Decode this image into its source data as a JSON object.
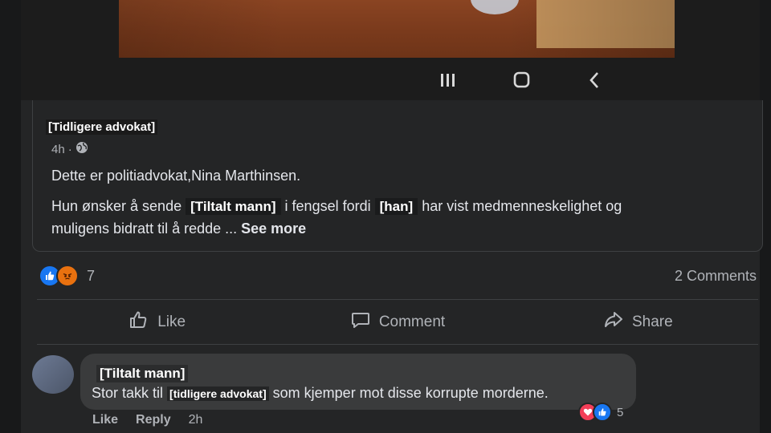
{
  "post": {
    "author": "[Tidligere advokat]",
    "time": "4h",
    "line1": "Dette er politiadvokat,Nina Marthinsen.",
    "line2_a": "Hun ønsker å sende",
    "line2_tag1": "[Tiltalt mann]",
    "line2_b": "i fengsel fordi",
    "line2_tag2": "[han]",
    "line2_c": "har  vist medmenneskelighet og",
    "line3_a": "muligens bidratt til å redde ...",
    "see_more": "See more"
  },
  "reactions": {
    "count": "7",
    "comments": "2 Comments"
  },
  "actions": {
    "like": "Like",
    "comment": "Comment",
    "share": "Share"
  },
  "comment": {
    "author": "[Tiltalt mann]",
    "text_a": "Stor takk til",
    "text_tag": "[tidligere advokat]",
    "text_b": "som kjemper mot disse korrupte morderne.",
    "reaction_count": "5",
    "like": "Like",
    "reply": "Reply",
    "time": "2h"
  },
  "icons": [
    "recents-icon",
    "home-icon",
    "back-icon",
    "globe-icon",
    "like-reaction-icon",
    "angry-reaction-icon",
    "like-icon",
    "comment-icon",
    "share-icon",
    "love-reaction-icon"
  ],
  "colors": {
    "background": "#18191a",
    "card": "#242526",
    "bubble": "#3a3b3c",
    "like_blue": "#1877f2",
    "angry_orange": "#e9710f",
    "love_red": "#f33e58"
  }
}
